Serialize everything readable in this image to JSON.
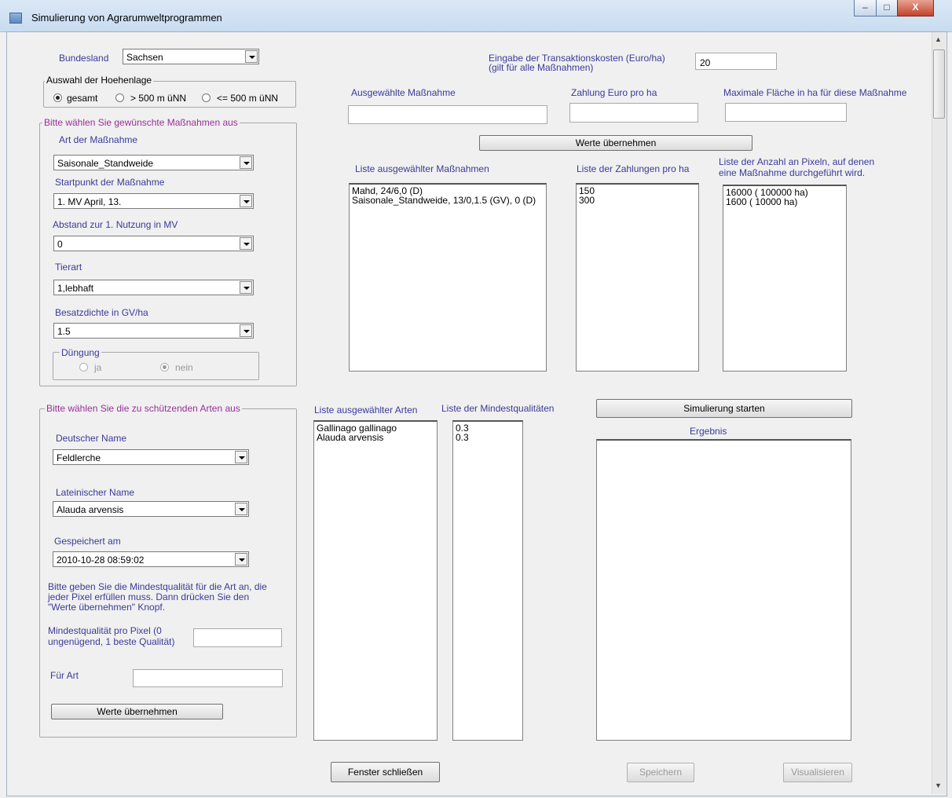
{
  "window": {
    "title": "Simulierung von Agrarumweltprogrammen",
    "controls": {
      "minimize": "–",
      "maximize": "□",
      "close": "X"
    }
  },
  "bundesland": {
    "label": "Bundesland",
    "value": "Sachsen"
  },
  "hoehenlage": {
    "legend": "Auswahl der Hoehenlage",
    "options": [
      "gesamt",
      "> 500 m üNN",
      "<= 500 m üNN"
    ],
    "selected": "gesamt"
  },
  "massnahmen": {
    "legend": "Bitte wählen Sie gewünschte Maßnahmen aus",
    "art_label": "Art der Maßnahme",
    "art_value": "Saisonale_Standweide",
    "start_label": "Startpunkt der Maßnahme",
    "start_value": "1. MV April, 13.",
    "abstand_label": "Abstand zur 1. Nutzung in MV",
    "abstand_value": "0",
    "tierart_label": "Tierart",
    "tierart_value": "1,lebhaft",
    "besatz_label": "Besatzdichte in GV/ha",
    "besatz_value": "1.5",
    "duengung": {
      "legend": "Düngung",
      "options": [
        "ja",
        "nein"
      ],
      "selected": "nein"
    }
  },
  "transaktion": {
    "label_line1": "Eingabe der Transaktionskosten (Euro/ha)",
    "label_line2": "(gilt für alle Maßnahmen)",
    "value": "20"
  },
  "top_fields": {
    "massnahme_label": "Ausgewählte Maßnahme",
    "zahlung_label": "Zahlung Euro pro ha",
    "flaeche_label": "Maximale Fläche in ha für diese Maßnahme"
  },
  "werte_button_top": "Werte übernehmen",
  "lists_top": {
    "massnahmen_label": "Liste ausgewählter Maßnahmen",
    "massnahmen_items": [
      "Mahd, 24/6,0 (D)",
      "Saisonale_Standweide, 13/0,1.5 (GV), 0 (D)"
    ],
    "zahlungen_label": "Liste der Zahlungen pro ha",
    "zahlungen_items": [
      "150",
      "300"
    ],
    "pixel_label_line1": "Liste der Anzahl an Pixeln, auf denen",
    "pixel_label_line2": "eine Maßnahme durchgeführt wird.",
    "pixel_items": [
      "16000 ( 100000 ha)",
      "1600 ( 10000 ha)"
    ]
  },
  "arten": {
    "legend": "Bitte wählen Sie die zu schützenden Arten aus",
    "deutsch_label": "Deutscher Name",
    "deutsch_value": "Feldlerche",
    "latein_label": "Lateinischer Name",
    "latein_value": "Alauda arvensis",
    "gespeichert_label": "Gespeichert am",
    "gespeichert_value": "2010-10-28 08:59:02",
    "hint_line1": "Bitte geben Sie die Mindestqualität für die Art an, die",
    "hint_line2": "jeder Pixel erfüllen muss. Dann drücken Sie den",
    "hint_line3": "\"Werte übernehmen\" Knopf.",
    "mindest_label_line1": "Mindestqualität pro Pixel (0",
    "mindest_label_line2": "ungenügend, 1 beste Qualität)",
    "fuer_art_label": "Für Art",
    "werte_button": "Werte übernehmen"
  },
  "lists_bottom": {
    "arten_label": "Liste ausgewählter Arten",
    "arten_items": [
      "Gallinago gallinago",
      "Alauda arvensis"
    ],
    "mindest_label": "Liste der Mindestqualitäten",
    "mindest_items": [
      "0.3",
      "0.3"
    ]
  },
  "simulation": {
    "start_button": "Simulierung starten",
    "ergebnis_label": "Ergebnis"
  },
  "footer": {
    "close_button": "Fenster schließen",
    "save_button": "Speichern",
    "visualize_button": "Visualisieren"
  }
}
